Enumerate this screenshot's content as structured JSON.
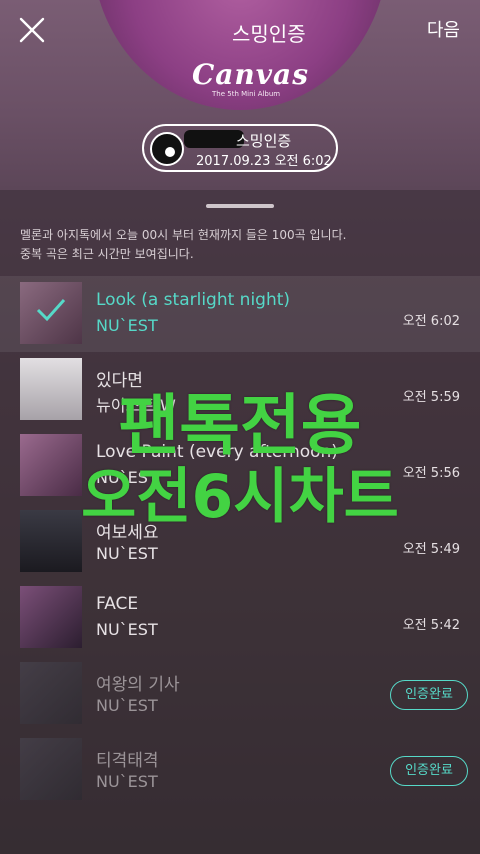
{
  "header": {
    "close_label": "",
    "next_label": "다음"
  },
  "album": {
    "caption": "스밍인증",
    "logo": "Canvas",
    "subtitle": "The 5th Mini Album"
  },
  "certificate": {
    "title": "스밍인증",
    "datetime": "2017.09.23 오전 6:02"
  },
  "notice": {
    "line1": "멜론과 아지톡에서 오늘 00시 부터 현재까지 들은 100곡 입니다.",
    "line2": "중복 곡은 최근 시간만 보여집니다."
  },
  "tracks": [
    {
      "title": "Look (a starlight night)",
      "artist": "NU`EST",
      "time": "오전 6:02",
      "state": "active",
      "thumb_color": "#6a4b63"
    },
    {
      "title": "있다면",
      "artist": "뉴이스트 W",
      "time": "오전 5:59",
      "state": "normal",
      "thumb_color": "#c9c6c9"
    },
    {
      "title": "Love Paint (every afternoon)",
      "artist": "NU`EST",
      "time": "오전 5:56",
      "state": "normal",
      "thumb_color": "#7b4f72"
    },
    {
      "title": "여보세요",
      "artist": "NU`EST",
      "time": "오전 5:49",
      "state": "normal",
      "thumb_color": "#2b2a32"
    },
    {
      "title": "FACE",
      "artist": "NU`EST",
      "time": "오전 5:42",
      "state": "normal",
      "thumb_color": "#5a3a5e"
    },
    {
      "title": "여왕의 기사",
      "artist": "NU`EST",
      "badge": "인증완료",
      "state": "dim",
      "thumb_color": "#3d3b44"
    },
    {
      "title": "티격태격",
      "artist": "NU`EST",
      "badge": "인증완료",
      "state": "dim",
      "thumb_color": "#3d3b44"
    }
  ],
  "overlay": {
    "line1": "팬톡전용",
    "line2": "오전6시차트"
  },
  "colors": {
    "accent": "#56d9c8",
    "overlay_green": "#43d343"
  }
}
